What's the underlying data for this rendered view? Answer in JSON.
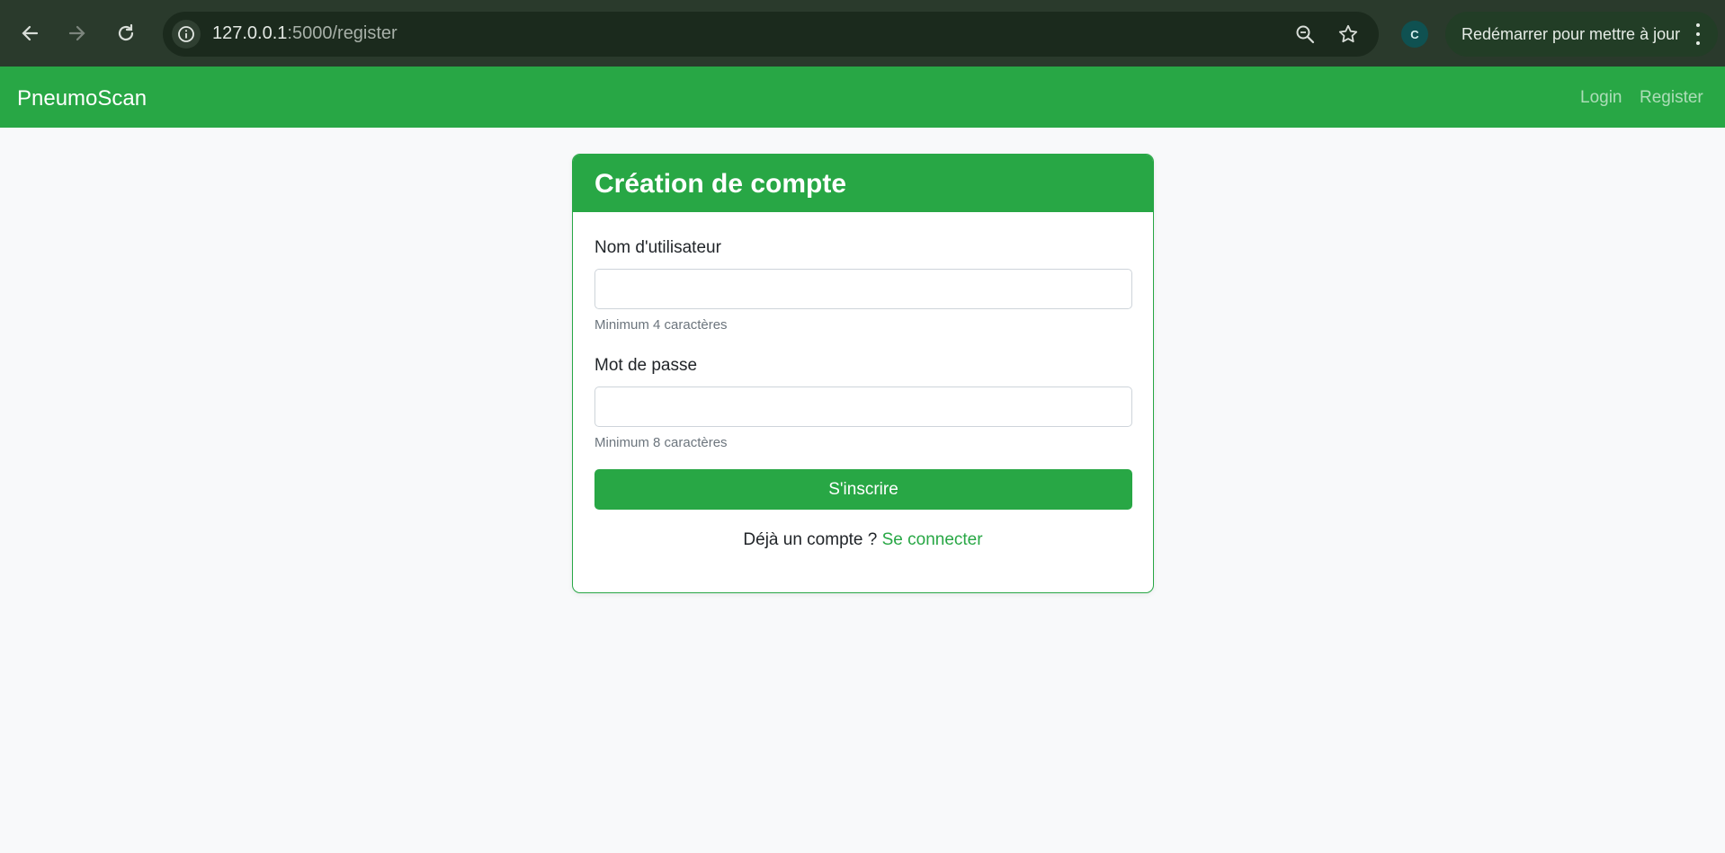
{
  "browser": {
    "url_host": "127.0.0.1",
    "url_path": ":5000/register",
    "profile_initial": "C",
    "update_label": "Redémarrer pour mettre à jour",
    "icons": [
      "back-arrow-icon",
      "forward-arrow-icon",
      "reload-icon",
      "site-info-icon",
      "zoom-icon",
      "bookmark-star-icon",
      "more-menu-icon"
    ]
  },
  "navbar": {
    "brand": "PneumoScan",
    "links": [
      "Login",
      "Register"
    ],
    "color": "#28a745"
  },
  "card": {
    "title": "Création de compte",
    "username_label": "Nom d'utilisateur",
    "username_value": "",
    "username_hint": "Minimum 4 caractères",
    "password_label": "Mot de passe",
    "password_value": "",
    "password_hint": "Minimum 8 caractères",
    "submit_label": "S'inscrire",
    "footer_text": "Déjà un compte ?",
    "footer_link": "Se connecter"
  },
  "colors": {
    "accent": "#28a745",
    "page_bg": "#f8f9fa"
  }
}
